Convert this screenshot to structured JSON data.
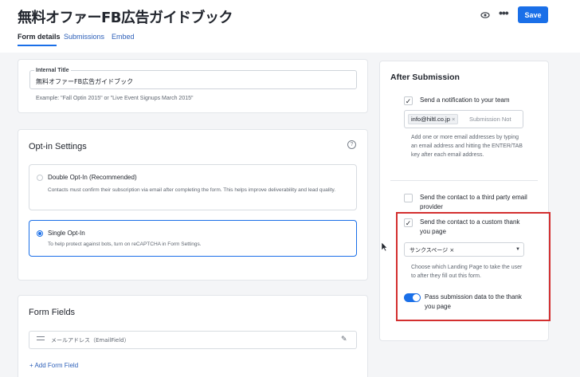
{
  "header": {
    "title": "無料オファーFB広告ガイドブック",
    "save_label": "Save",
    "tabs": [
      "Form details",
      "Submissions",
      "Embed"
    ]
  },
  "internal_title": {
    "label": "Internal Title",
    "value": "無料オファーFB広告ガイドブック",
    "example": "Example: \"Fall Optin 2015\" or \"Live Event Signups March 2015\""
  },
  "optin": {
    "heading": "Opt-in Settings",
    "help": "?",
    "double_title": "Double Opt-In (Recommended)",
    "double_desc": "Contacts must confirm their subscription via email after completing the form. This helps improve deliverability and lead quality.",
    "single_title": "Single Opt-In",
    "single_desc": "To help protect against bots, turn on reCAPTCHA in Form Settings."
  },
  "form_fields": {
    "heading": "Form Fields",
    "row": "メールアドレス（EmailField）",
    "add": "+ Add Form Field"
  },
  "after": {
    "heading": "After Submission",
    "notify_label": "Send a notification to your team",
    "email_chip": "info@hiltl.co.jp",
    "email_placeholder": "Submission Not",
    "email_hint": "Add one or more email addresses by typing an email address and hitting the ENTER/TAB key after each email address.",
    "third_party": "Send the contact to a third party email provider",
    "custom_page": "Send the contact to a custom thank you page",
    "select_value": "サンクスページ",
    "select_hint": "Choose which Landing Page to take the user to after they fill out this form.",
    "pass_data": "Pass submission data to the thank you page"
  },
  "colors": {
    "accent": "#1a6fe8",
    "highlight": "#d32f2f"
  }
}
